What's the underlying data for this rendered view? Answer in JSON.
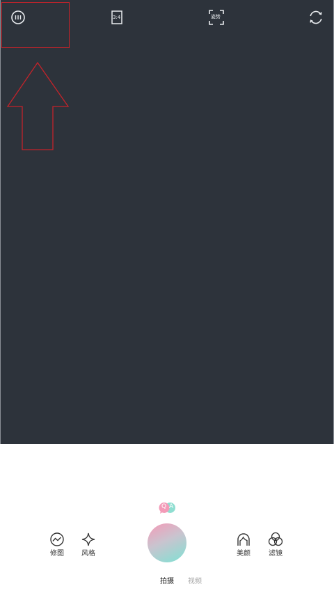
{
  "top_bar": {
    "aspect_ratio": "3:4",
    "pose_label": "姿势"
  },
  "tools_left": [
    {
      "label": "修图",
      "icon": "retouch-icon"
    },
    {
      "label": "风格",
      "icon": "sparkle-icon"
    }
  ],
  "tools_right": [
    {
      "label": "美颜",
      "icon": "face-icon"
    },
    {
      "label": "滤镜",
      "icon": "filter-circles-icon"
    }
  ],
  "badge": {
    "left": "Q",
    "right": "A"
  },
  "modes": [
    {
      "label": "拍摄",
      "active": true
    },
    {
      "label": "视频",
      "active": false
    }
  ],
  "colors": {
    "viewfinder": "#2d333b",
    "annotation": "#c4232a",
    "shutter_pink": "#f59ab7",
    "shutter_teal": "#7fe1d3"
  }
}
